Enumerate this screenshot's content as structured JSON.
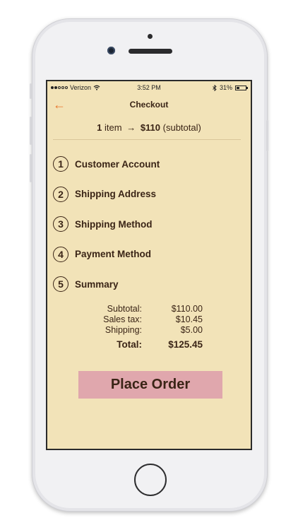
{
  "status_bar": {
    "carrier": "Verizon",
    "time": "3:52 PM",
    "battery": "31%",
    "battery_level": 0.31,
    "signal_bars_filled": 2,
    "signal_bars_total": 5,
    "icons": [
      "wifi-icon",
      "bluetooth-icon",
      "battery-icon"
    ]
  },
  "nav": {
    "title": "Checkout",
    "back_icon": "back-arrow-icon",
    "accent_color": "#e8772e"
  },
  "cart_summary": {
    "count": "1",
    "item_word": "item",
    "arrow": "→",
    "amount": "$110",
    "suffix": "(subtotal)"
  },
  "steps": [
    {
      "number": "1",
      "label": "Customer Account"
    },
    {
      "number": "2",
      "label": "Shipping Address"
    },
    {
      "number": "3",
      "label": "Shipping Method"
    },
    {
      "number": "4",
      "label": "Payment Method"
    },
    {
      "number": "5",
      "label": "Summary"
    }
  ],
  "totals": {
    "subtotal_label": "Subtotal:",
    "subtotal": "$110.00",
    "tax_label": "Sales tax:",
    "tax": "$10.45",
    "shipping_label": "Shipping:",
    "shipping": "$5.00",
    "total_label": "Total:",
    "total": "$125.45"
  },
  "place_order": {
    "label": "Place Order",
    "color": "#e0a7ad"
  },
  "colors": {
    "screen_background": "#f2e3b8",
    "text": "#3a2416"
  }
}
